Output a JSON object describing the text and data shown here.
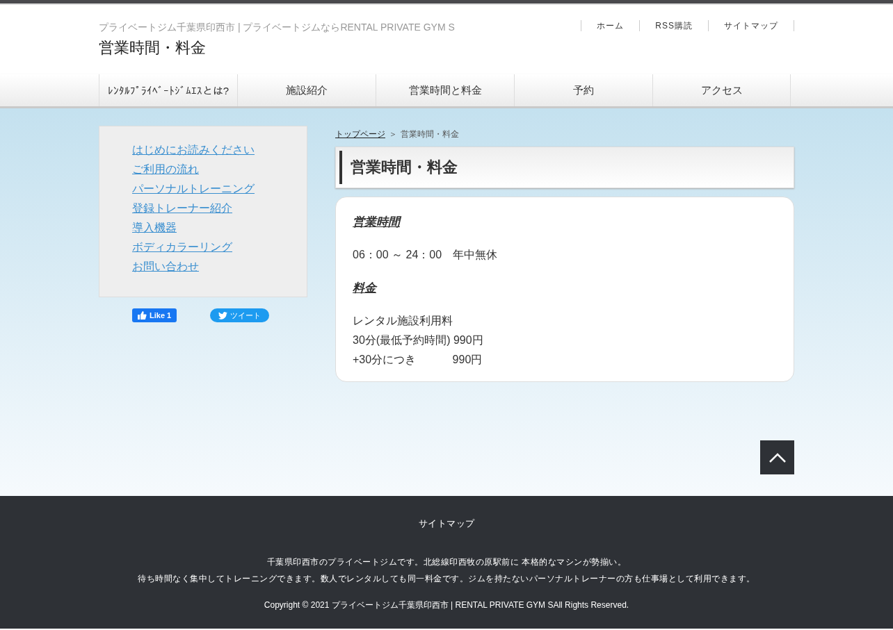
{
  "header": {
    "site_title": "プライベートジム千葉県印西市 | プライベートジムならRENTAL PRIVATE GYM S",
    "page_title": "営業時間・料金",
    "links": [
      "ホーム",
      "RSS購読",
      "サイトマップ"
    ]
  },
  "nav": [
    "ﾚﾝﾀﾙﾌﾟﾗｲﾍﾞｰﾄｼﾞﾑｴｽとは?",
    "施設紹介",
    "営業時間と料金",
    "予約",
    "アクセス"
  ],
  "sidebar": {
    "links": [
      "はじめにお読みください",
      "ご利用の流れ",
      "パーソナルトレーニング",
      "登録トレーナー紹介",
      "導入機器",
      "ボディカラーリング",
      "お問い合わせ"
    ],
    "like_button": "Like 1",
    "tweet_button": "ツイート"
  },
  "breadcrumb": {
    "link": "トップページ",
    "separator": "＞",
    "current": "営業時間・料金"
  },
  "article": {
    "title": "営業時間・料金",
    "blocks": [
      {
        "kind": "heading",
        "text": "営業時間"
      },
      {
        "kind": "text",
        "lines": [
          "06：00 ～ 24：00　年中無休"
        ]
      },
      {
        "kind": "heading",
        "text": "料金"
      },
      {
        "kind": "text",
        "lines": [
          "レンタル施設利用料",
          "30分(最低予約時間) 990円",
          "+30分につき　　　 990円"
        ]
      }
    ]
  },
  "footer": {
    "sitemap_link": "サイトマップ",
    "description": [
      "千葉県印西市のプライベートジムです。北総線印西牧の原駅前に 本格的なマシンが勢揃い。",
      "待ち時間なく集中してトレーニングできます。数人でレンタルしても同一料金です。ジムを持たないパーソナルトレーナーの方も仕事場として利用できます。"
    ],
    "copyright": "Copyright © 2021 プライベートジム千葉県印西市 | RENTAL PRIVATE GYM SAll Rights Reserved."
  }
}
